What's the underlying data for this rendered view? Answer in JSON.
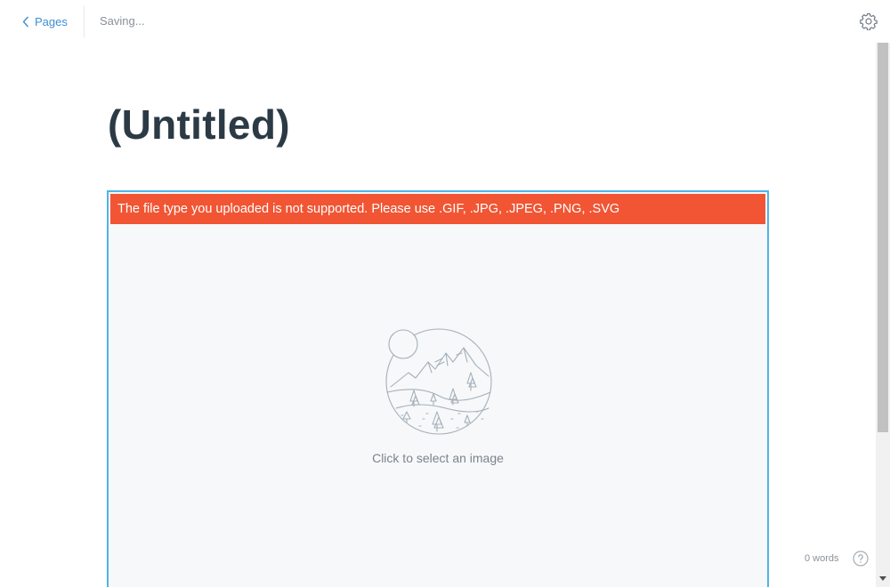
{
  "topbar": {
    "back_label": "Pages",
    "status": "Saving..."
  },
  "page": {
    "title": "(Untitled)"
  },
  "image_block": {
    "error_message": "The file type you uploaded is not supported. Please use .GIF, .JPG, .JPEG, .PNG, .SVG",
    "prompt": "Click to select an image"
  },
  "footer": {
    "word_count": "0 words"
  },
  "icons": {
    "back": "chevron-left-icon",
    "settings": "gear-icon",
    "placeholder": "landscape-illustration-icon",
    "help": "question-circle-icon"
  },
  "colors": {
    "accent": "#3d8fd1",
    "focus_border": "#4fb3e8",
    "error": "#f15533",
    "title": "#2b3a44",
    "muted": "#8a9199"
  }
}
